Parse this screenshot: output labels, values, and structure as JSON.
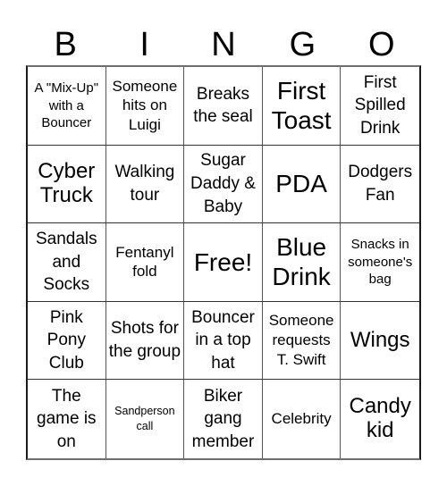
{
  "header": {
    "letters": [
      "B",
      "I",
      "N",
      "G",
      "O"
    ]
  },
  "board": {
    "rows": [
      [
        {
          "text": "A \"Mix-Up\" with a Bouncer",
          "size": "xs"
        },
        {
          "text": "Someone hits on Luigi",
          "size": "sm"
        },
        {
          "text": "Breaks the seal",
          "size": "md"
        },
        {
          "text": "First Toast",
          "size": "xl"
        },
        {
          "text": "First Spilled Drink",
          "size": "md"
        }
      ],
      [
        {
          "text": "Cyber Truck",
          "size": "lg"
        },
        {
          "text": "Walking tour",
          "size": "md"
        },
        {
          "text": "Sugar Daddy & Baby",
          "size": "md"
        },
        {
          "text": "PDA",
          "size": "xl"
        },
        {
          "text": "Dodgers Fan",
          "size": "md"
        }
      ],
      [
        {
          "text": "Sandals and Socks",
          "size": "md"
        },
        {
          "text": "Fentanyl fold",
          "size": "sm"
        },
        {
          "text": "Free!",
          "size": "xl"
        },
        {
          "text": "Blue Drink",
          "size": "xl"
        },
        {
          "text": "Snacks in someone's bag",
          "size": "xs"
        }
      ],
      [
        {
          "text": "Pink Pony Club",
          "size": "md"
        },
        {
          "text": "Shots for the group",
          "size": "md"
        },
        {
          "text": "Bouncer in a top hat",
          "size": "md"
        },
        {
          "text": "Someone requests T. Swift",
          "size": "sm"
        },
        {
          "text": "Wings",
          "size": "lg"
        }
      ],
      [
        {
          "text": "The game is on",
          "size": "md"
        },
        {
          "text": "Sandperson call",
          "size": "xxs"
        },
        {
          "text": "Biker gang member",
          "size": "md"
        },
        {
          "text": "Celebrity",
          "size": "sm"
        },
        {
          "text": "Candy kid",
          "size": "lg"
        }
      ]
    ]
  }
}
